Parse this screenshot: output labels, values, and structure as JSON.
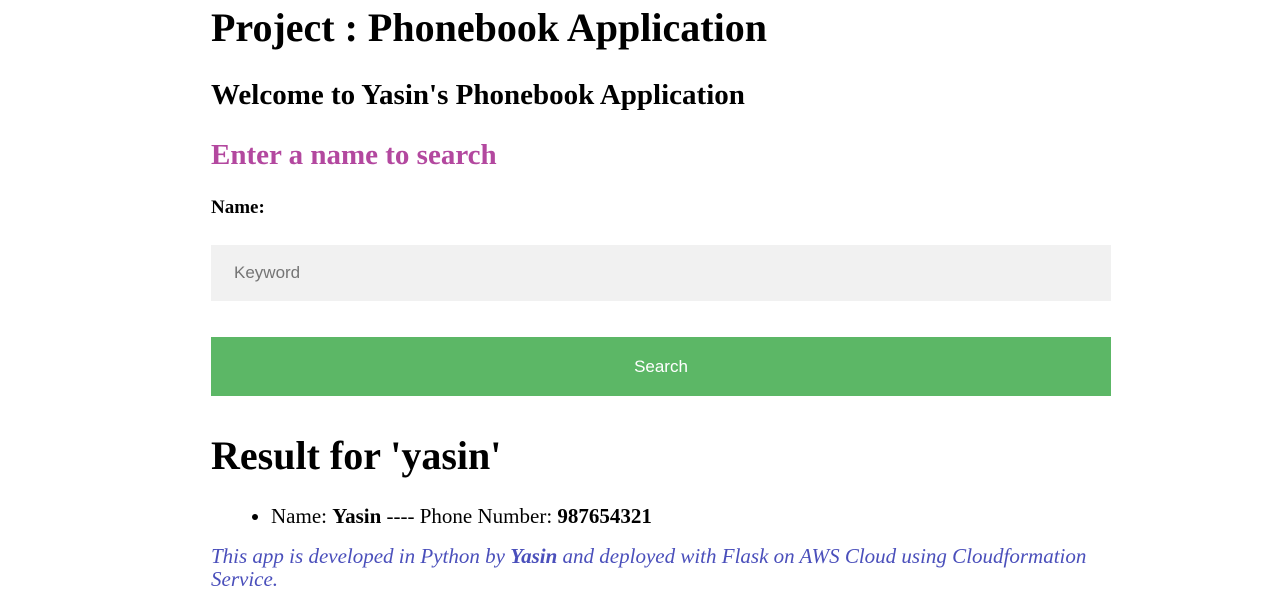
{
  "page": {
    "project_title": "Project : Phonebook Application",
    "welcome_text": "Welcome to Yasin's Phonebook Application",
    "search_heading": "Enter a name to search"
  },
  "search_form": {
    "name_label": "Name:",
    "keyword_value": "",
    "keyword_placeholder": "Keyword",
    "search_button_label": "Search"
  },
  "results": {
    "title": "Result for 'yasin'",
    "items": [
      {
        "name_label": "Name:",
        "name_value": "Yasin",
        "separator": "----",
        "phone_label": "Phone Number:",
        "phone_value": "987654321"
      }
    ]
  },
  "footer": {
    "text_before": "This app is developed in Python by ",
    "author": "Yasin",
    "text_after": " and deployed with Flask on AWS Cloud using Cloudformation Service."
  },
  "colors": {
    "search_heading": "#b3489f",
    "button_bg": "#5cb766",
    "input_bg": "#f1f1f1",
    "footer_text": "#4a4fbb"
  }
}
